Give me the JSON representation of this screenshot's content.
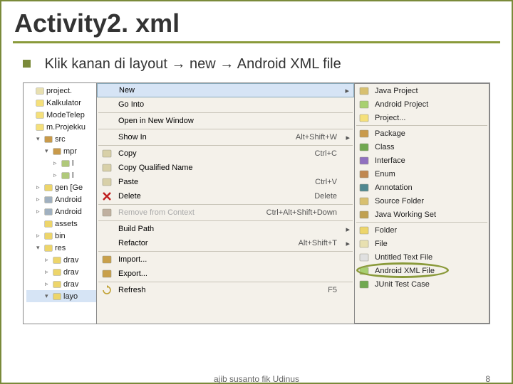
{
  "title": "Activity2. xml",
  "instruction_parts": {
    "p1": "Klik kanan di layout",
    "p2": "new",
    "p3": "Android XML file"
  },
  "tree": [
    {
      "label": "project.",
      "icon": "file",
      "indent": 0
    },
    {
      "label": "Kalkulator",
      "icon": "proj",
      "indent": 0
    },
    {
      "label": "ModeTelep",
      "icon": "proj",
      "indent": 0
    },
    {
      "label": "m.Projekku",
      "icon": "proj",
      "indent": 0
    },
    {
      "label": "src",
      "icon": "pkg",
      "indent": 1,
      "expand": "▾"
    },
    {
      "label": "mpr",
      "icon": "pkg",
      "indent": 2,
      "expand": "▾"
    },
    {
      "label": "l",
      "icon": "jfile",
      "indent": 3,
      "tri": "▹"
    },
    {
      "label": "l",
      "icon": "jfile",
      "indent": 3,
      "tri": "▹"
    },
    {
      "label": "gen [Ge",
      "icon": "folder",
      "indent": 1,
      "tri": "▹"
    },
    {
      "label": "Android",
      "icon": "lib",
      "indent": 1,
      "tri": "▹"
    },
    {
      "label": "Android",
      "icon": "lib",
      "indent": 1,
      "tri": "▹"
    },
    {
      "label": "assets",
      "icon": "folder",
      "indent": 1
    },
    {
      "label": "bin",
      "icon": "folder",
      "indent": 1,
      "tri": "▹"
    },
    {
      "label": "res",
      "icon": "folder",
      "indent": 1,
      "expand": "▾"
    },
    {
      "label": "drav",
      "icon": "folder",
      "indent": 2,
      "tri": "▹"
    },
    {
      "label": "drav",
      "icon": "folder",
      "indent": 2,
      "tri": "▹"
    },
    {
      "label": "drav",
      "icon": "folder",
      "indent": 2,
      "tri": "▹"
    },
    {
      "label": "layo",
      "icon": "folder",
      "indent": 2,
      "expand": "▾",
      "sel": true
    }
  ],
  "context_menu": [
    {
      "label": "New",
      "highlight": true,
      "arrow": "▸"
    },
    {
      "label": "Go Into"
    },
    {
      "sep": true
    },
    {
      "label": "Open in New Window"
    },
    {
      "sep": true
    },
    {
      "label": "Show In",
      "shortcut": "Alt+Shift+W",
      "arrow": "▸"
    },
    {
      "sep": true
    },
    {
      "label": "Copy",
      "icon": "copy",
      "shortcut": "Ctrl+C"
    },
    {
      "label": "Copy Qualified Name",
      "icon": "copy"
    },
    {
      "label": "Paste",
      "icon": "paste",
      "shortcut": "Ctrl+V"
    },
    {
      "label": "Delete",
      "icon": "delete",
      "shortcut": "Delete"
    },
    {
      "sep": true
    },
    {
      "label": "Remove from Context",
      "icon": "remove",
      "shortcut": "Ctrl+Alt+Shift+Down",
      "disabled": true
    },
    {
      "sep": true
    },
    {
      "label": "Build Path",
      "arrow": "▸"
    },
    {
      "label": "Refactor",
      "shortcut": "Alt+Shift+T",
      "arrow": "▸"
    },
    {
      "sep": true
    },
    {
      "label": "Import...",
      "icon": "import"
    },
    {
      "label": "Export...",
      "icon": "export"
    },
    {
      "sep": true
    },
    {
      "label": "Refresh",
      "icon": "refresh",
      "shortcut": "F5"
    }
  ],
  "submenu": [
    {
      "label": "Java Project",
      "icon": "jproj"
    },
    {
      "label": "Android Project",
      "icon": "aproj"
    },
    {
      "label": "Project...",
      "icon": "proj"
    },
    {
      "sep": true
    },
    {
      "label": "Package",
      "icon": "pkg"
    },
    {
      "label": "Class",
      "icon": "class"
    },
    {
      "label": "Interface",
      "icon": "iface"
    },
    {
      "label": "Enum",
      "icon": "enum"
    },
    {
      "label": "Annotation",
      "icon": "annot"
    },
    {
      "label": "Source Folder",
      "icon": "srcf"
    },
    {
      "label": "Java Working Set",
      "icon": "jws"
    },
    {
      "sep": true
    },
    {
      "label": "Folder",
      "icon": "folder"
    },
    {
      "label": "File",
      "icon": "file"
    },
    {
      "label": "Untitled Text File",
      "icon": "txtfile"
    },
    {
      "label": "Android XML File",
      "icon": "axml",
      "oval": true
    },
    {
      "label": "JUnit Test Case",
      "icon": "junit"
    }
  ],
  "footer": {
    "center": "ajib susanto fik Udinus",
    "page": "8"
  }
}
